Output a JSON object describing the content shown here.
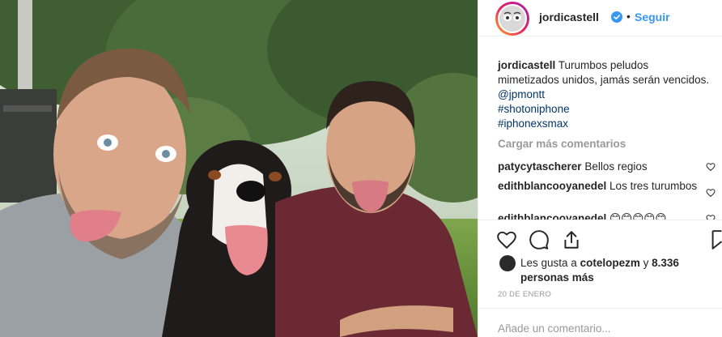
{
  "post": {
    "username": "jordicastell",
    "verified_icon": "verified-badge-icon",
    "separator": "•",
    "follow_label": "Seguir",
    "caption": {
      "username": "jordicastell",
      "text": "Turumbos peludos mimetizados unidos, jamás serán vencidos.",
      "mention": "@jpmontt",
      "hashtags": [
        "#shotoniphone",
        "#iphonexsmax"
      ]
    },
    "load_more_label": "Cargar más comentarios",
    "comments": [
      {
        "username": "patycytascherer",
        "text": "Bellos regios"
      },
      {
        "username": "edithblancooyanedel",
        "text": "Los tres turumbos"
      },
      {
        "username": "edithblancooyanedel",
        "text": "😊😊😊😊😊"
      }
    ],
    "likes": {
      "prefix": "Les gusta a",
      "user": "cotelopezm",
      "connector": "y",
      "count": "8.336 personas más"
    },
    "date": "20 DE ENERO",
    "add_comment_placeholder": "Añade un comentario...",
    "colors": {
      "link": "#003569",
      "follow": "#3897f0",
      "muted": "#999999",
      "text": "#262626"
    }
  }
}
